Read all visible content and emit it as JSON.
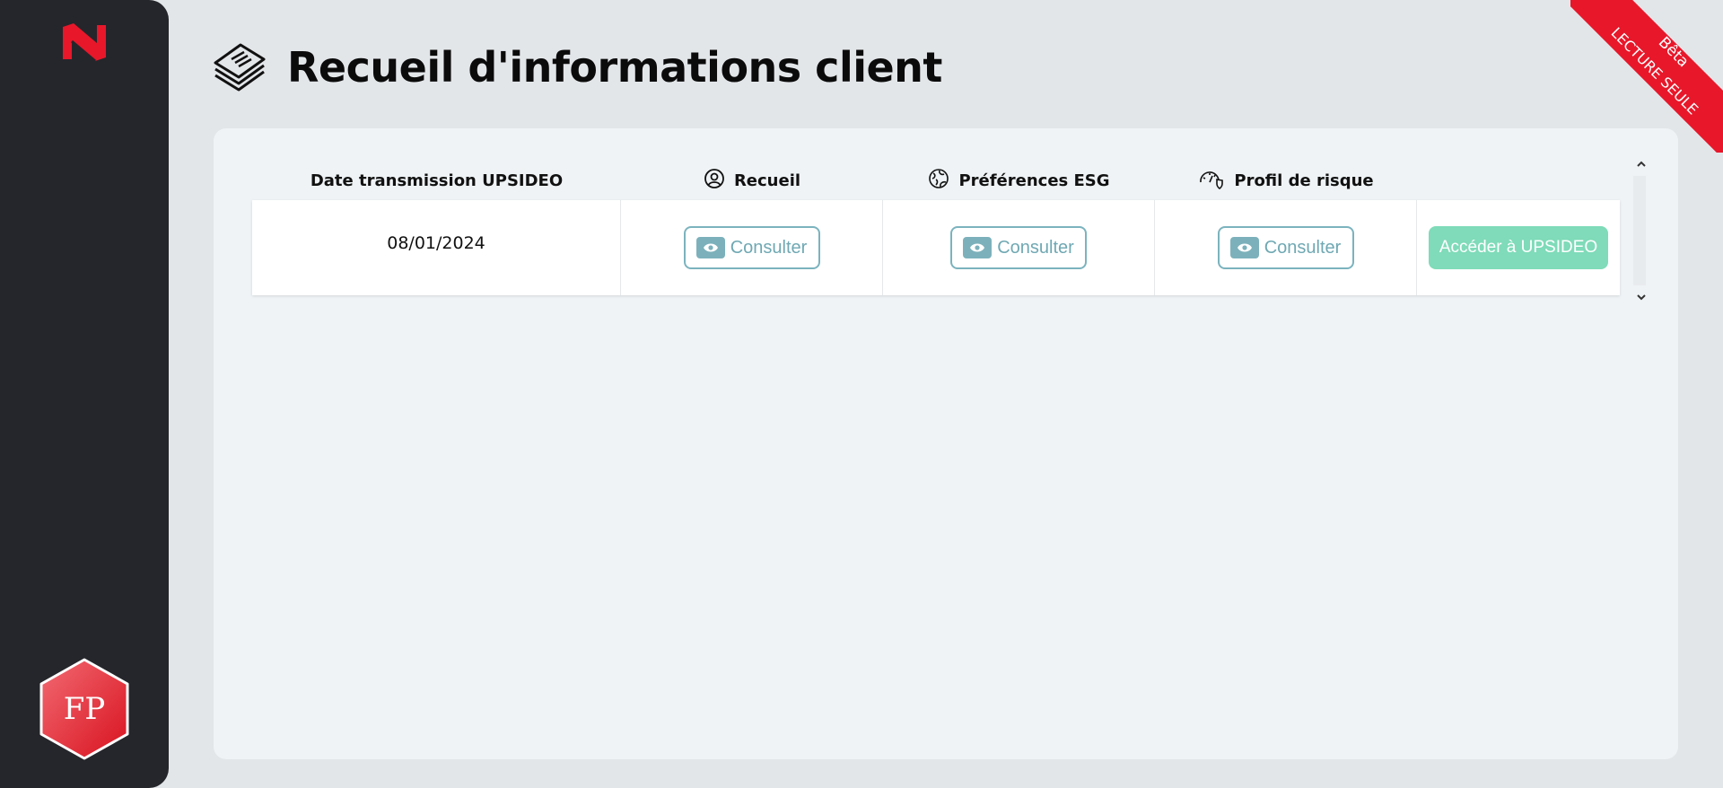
{
  "sidebar": {
    "logo_icon": "nb-logo-icon",
    "avatar_initials": "FP",
    "brand_color": "#e8172a"
  },
  "header": {
    "title": "Recueil d'informations client",
    "icon": "stack-of-papers-icon"
  },
  "ribbon": {
    "beta_label": "Bêta",
    "readonly_label": "LECTURE SEULE"
  },
  "table": {
    "columns": [
      {
        "label": "Date transmission UPSIDEO",
        "icon": ""
      },
      {
        "label": "Recueil",
        "icon": "user-circle-icon"
      },
      {
        "label": "Préférences ESG",
        "icon": "globe-leaf-icon"
      },
      {
        "label": "Profil de risque",
        "icon": "gauge-shield-icon"
      }
    ],
    "rows": [
      {
        "date": "08/01/2024",
        "recueil_action": "Consulter",
        "esg_action": "Consulter",
        "risk_action": "Consulter",
        "upsideo_action": "Accéder à UPSIDEO"
      }
    ]
  },
  "colors": {
    "consult_border": "#7bb3be",
    "upsideo_button": "#7fdbb9",
    "sidebar_bg": "#25262b"
  }
}
